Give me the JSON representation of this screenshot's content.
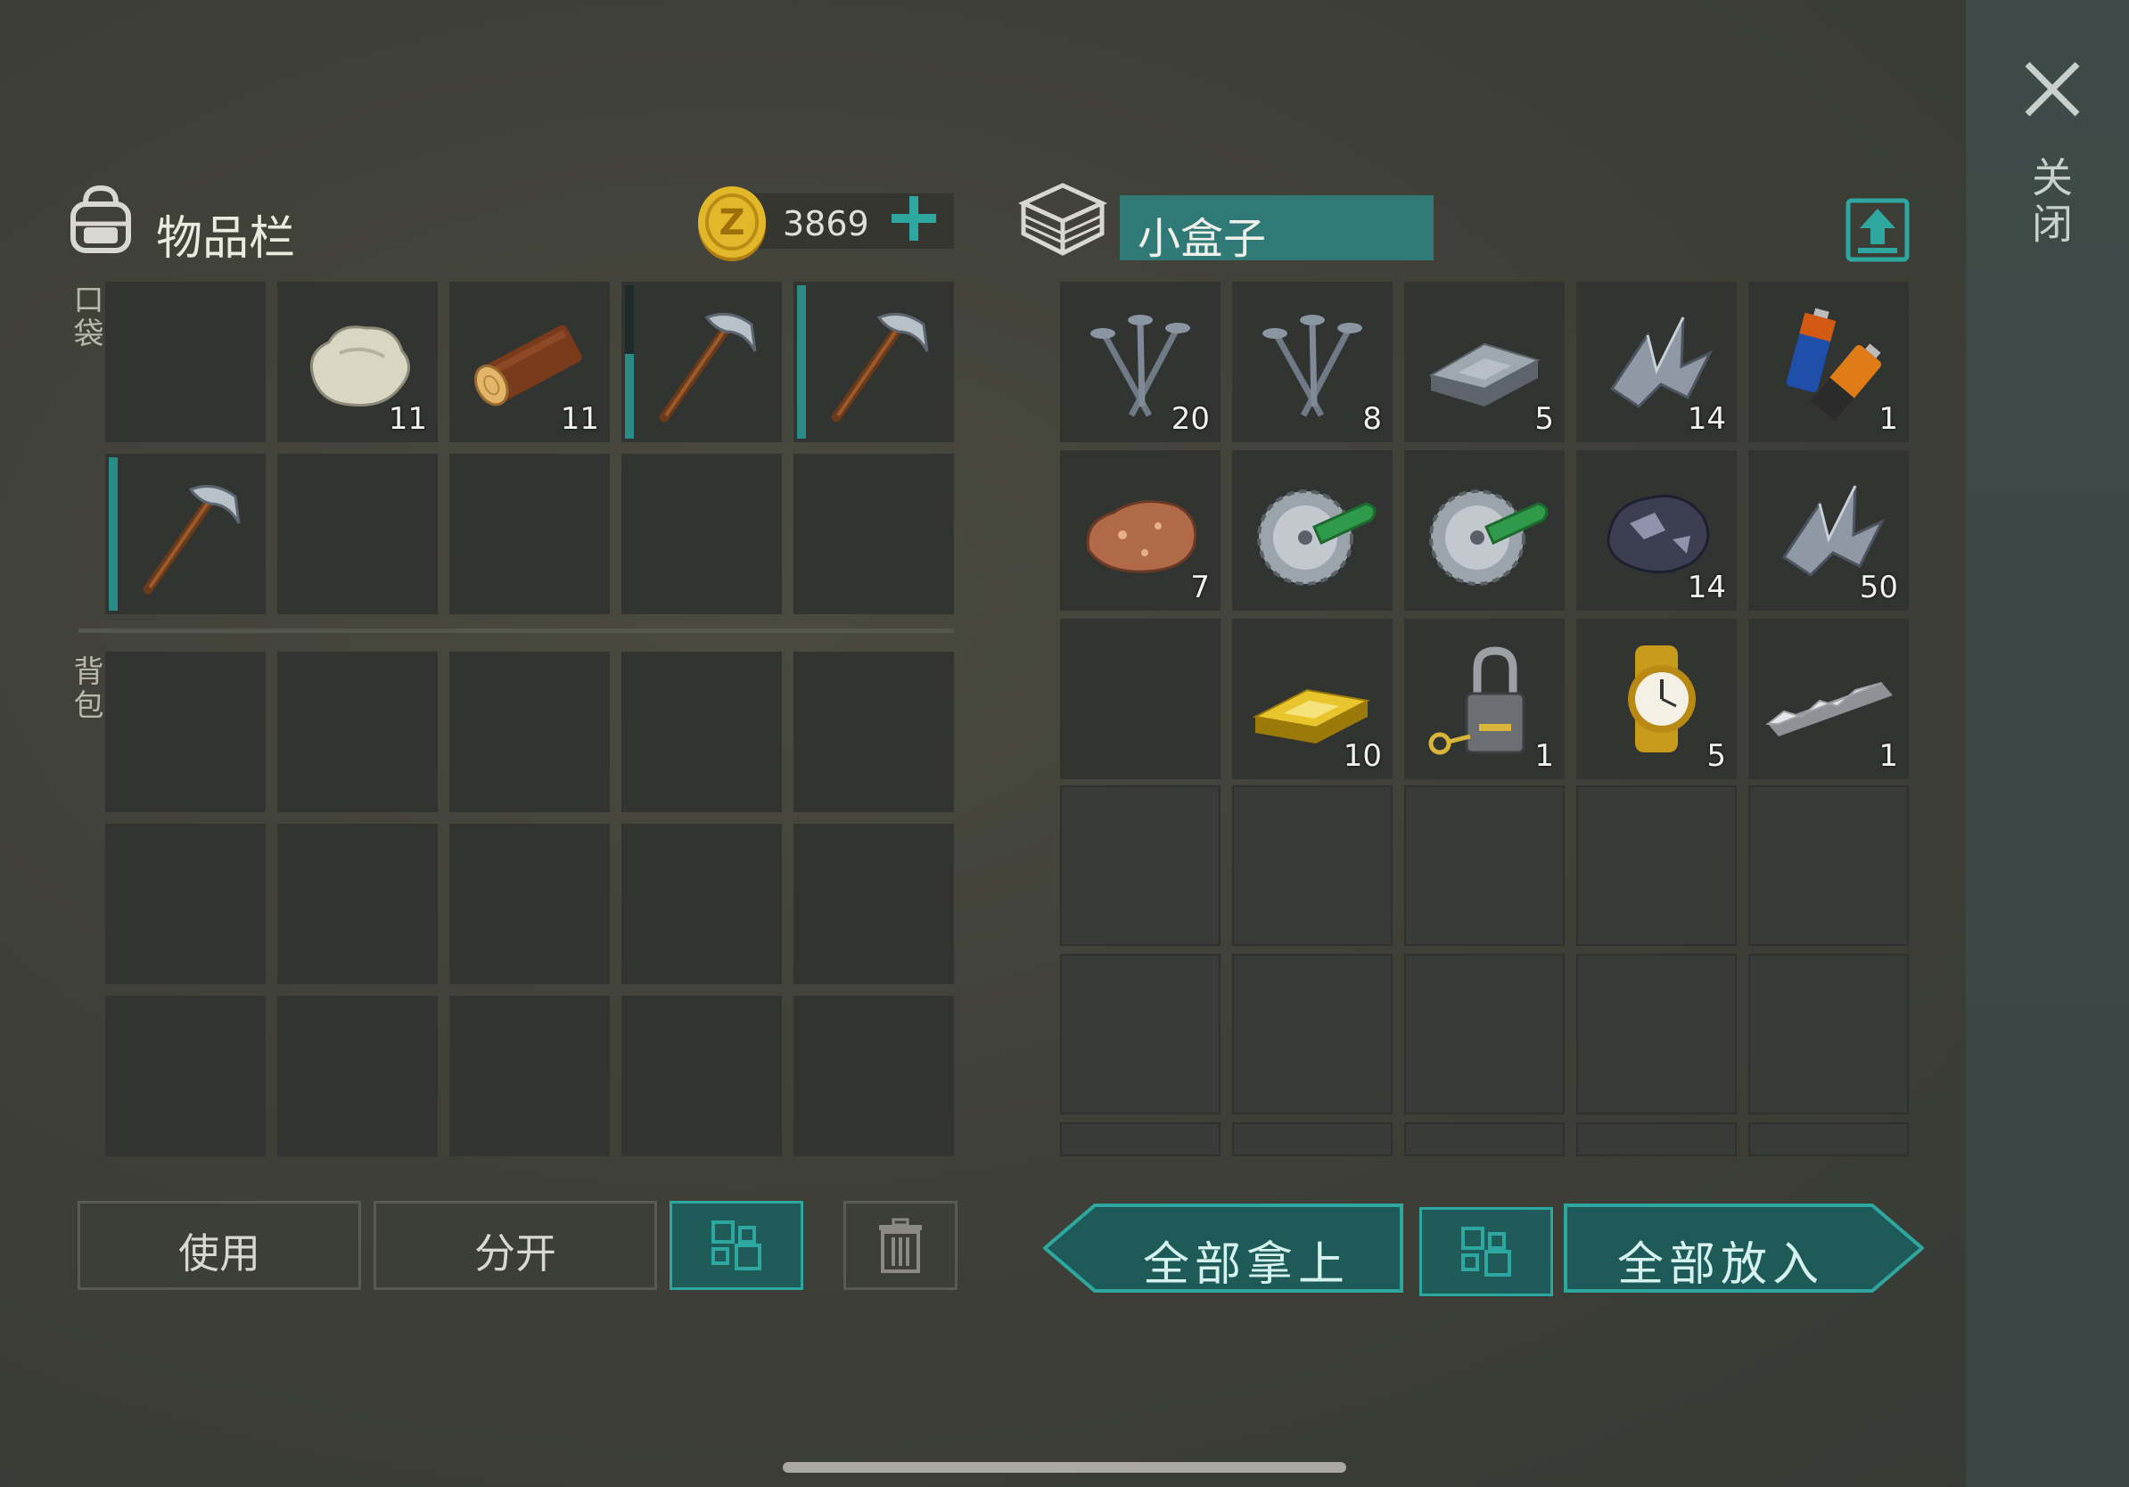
{
  "inventory": {
    "title": "物品栏",
    "coins": "3869",
    "pocket_label": "口袋",
    "backpack_label": "背包",
    "pocket_slots": [
      {
        "icon": "",
        "count": ""
      },
      {
        "icon": "stone-icon",
        "count": "11"
      },
      {
        "icon": "log-icon",
        "count": "11"
      },
      {
        "icon": "pickaxe-icon",
        "count": "",
        "durability": 0.55
      },
      {
        "icon": "pickaxe-icon",
        "count": "",
        "durability": 1.0
      },
      {
        "icon": "pickaxe-icon",
        "count": "",
        "durability": 1.0
      },
      {
        "icon": "",
        "count": ""
      },
      {
        "icon": "",
        "count": ""
      },
      {
        "icon": "",
        "count": ""
      },
      {
        "icon": "",
        "count": ""
      }
    ],
    "buttons": {
      "use": "使用",
      "split": "分开"
    }
  },
  "container": {
    "title": "小盒子",
    "slots": [
      {
        "icon": "nails-icon",
        "count": "20"
      },
      {
        "icon": "nails-icon",
        "count": "8"
      },
      {
        "icon": "iron-ingot-icon",
        "count": "5"
      },
      {
        "icon": "metal-scrap-icon",
        "count": "14"
      },
      {
        "icon": "batteries-icon",
        "count": "1"
      },
      {
        "icon": "copper-ore-icon",
        "count": "7"
      },
      {
        "icon": "saw-blade-icon",
        "count": ""
      },
      {
        "icon": "saw-blade-icon",
        "count": ""
      },
      {
        "icon": "iron-ore-icon",
        "count": "14"
      },
      {
        "icon": "metal-scrap-icon",
        "count": "50"
      },
      {
        "icon": "",
        "count": ""
      },
      {
        "icon": "gold-bar-icon",
        "count": "10"
      },
      {
        "icon": "padlock-icon",
        "count": "1"
      },
      {
        "icon": "gold-watch-icon",
        "count": "5"
      },
      {
        "icon": "silver-bar-icon",
        "count": "1"
      }
    ],
    "buttons": {
      "take_all": "全部拿上",
      "put_all": "全部放入"
    }
  },
  "close_label": "关闭",
  "colors": {
    "accent": "#2ea7a0",
    "slot_bg": "#313430",
    "teal_dark": "#1f5b59"
  }
}
